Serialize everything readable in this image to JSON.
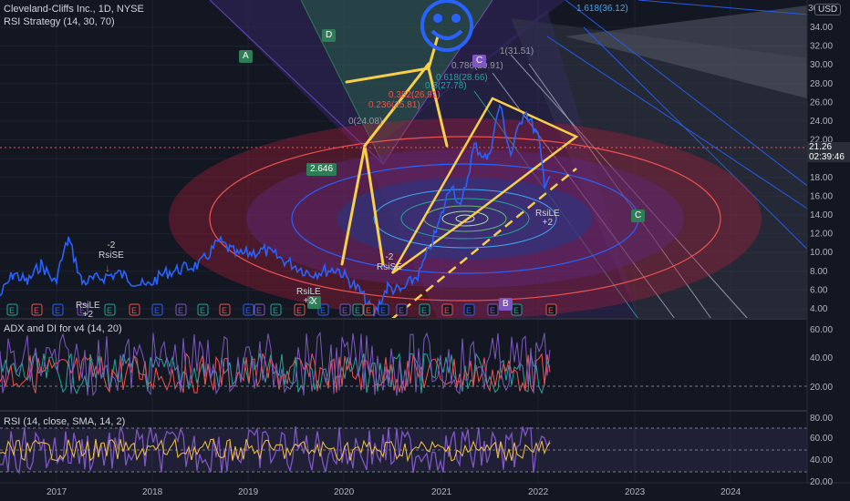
{
  "symbol": {
    "title": "Cleveland-Cliffs Inc., 1D, NYSE",
    "strategy": "RSI Strategy (14, 30, 70)",
    "current_price": "21.26",
    "countdown": "02:39:46",
    "currency": "USD"
  },
  "panes": {
    "adx_label": "ADX and DI for v4 (14, 20)",
    "rsi_label": "RSI (14, close, SMA, 14, 2)"
  },
  "axes": {
    "price_ticks": [
      "34.00",
      "32.00",
      "30.00",
      "28.00",
      "26.00",
      "24.00",
      "22.00",
      "20.00",
      "18.00",
      "16.00",
      "14.00",
      "12.00",
      "10.00",
      "8.00",
      "6.00",
      "4.00"
    ],
    "adx_ticks": [
      "60.00",
      "40.00",
      "20.00"
    ],
    "rsi_ticks": [
      "80.00",
      "60.00",
      "40.00",
      "20.00"
    ],
    "years": [
      "2017",
      "2018",
      "2019",
      "2020",
      "2021",
      "2022",
      "2023",
      "2024"
    ],
    "price_top_partial": "36"
  },
  "annotations": {
    "fib_ext": "1.618(36.12)",
    "fib_1": "1(31.51)",
    "fib_0786": "0.786(29.91)",
    "fib_0618": "0.618(28.66)",
    "fib_05": "0.5(27.78)",
    "fib_0382": "0.382(26.91)",
    "fib_0236": "0.236(25.81)",
    "fib_0": "0(24.08)",
    "ratio": "2.646",
    "rsi_se_1": "-2",
    "rsi_se_1b": "RsiSE",
    "rsi_se_2": "-2",
    "rsi_se_2b": "RsiSE",
    "rsi_le_1": "RsiLE",
    "rsi_le_1b": "+2",
    "rsi_le_2": "RsiLE",
    "rsi_le_2b": "+2",
    "rsi_le_3": "RsiLE",
    "rsi_le_3b": "+2",
    "pt_a": "A",
    "pt_b": "B",
    "pt_c": "C",
    "pt_d": "D",
    "pt_x": "X",
    "earnings": "E"
  },
  "colors": {
    "background": "#131722",
    "price_line": "#2962ff",
    "up": "#26a69a",
    "down": "#ef5350",
    "yellow": "#f7d04b",
    "rsi_line": "#7e57c2",
    "rsi_ma": "#f7c444"
  }
}
